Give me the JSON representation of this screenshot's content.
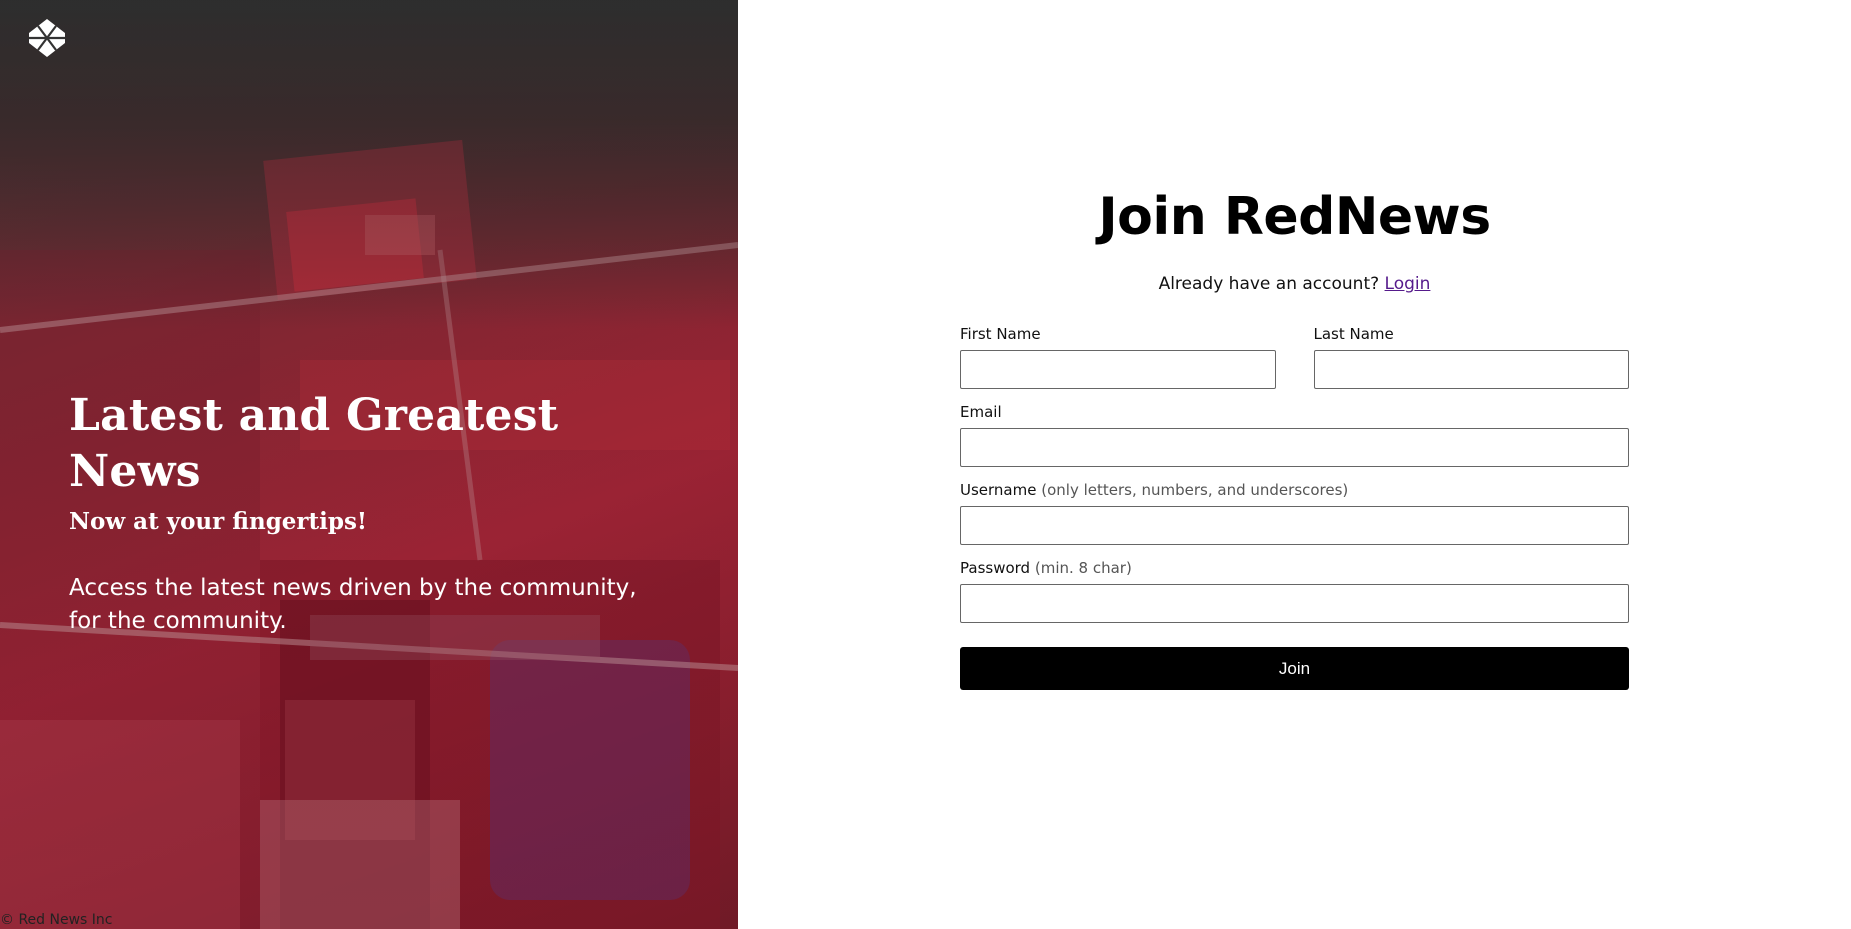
{
  "hero": {
    "logo_icon": "diamond-grid-logo-icon",
    "title": "Latest and Greatest News",
    "subtitle": "Now at your fingertips!",
    "description": "Access the latest news driven by the community, for the community.",
    "copyright": "© Red News Inc"
  },
  "form": {
    "title": "Join RedNews",
    "already_text": "Already have an account?",
    "login_link": "Login",
    "first_name_label": "First Name",
    "last_name_label": "Last Name",
    "email_label": "Email",
    "username_label": "Username",
    "username_hint": "(only letters, numbers, and underscores)",
    "password_label": "Password",
    "password_hint": "(min. 8 char)",
    "join_button": "Join"
  },
  "colors": {
    "hero_tint": "#a52638",
    "button_bg": "#000000",
    "link": "#551a8b"
  }
}
